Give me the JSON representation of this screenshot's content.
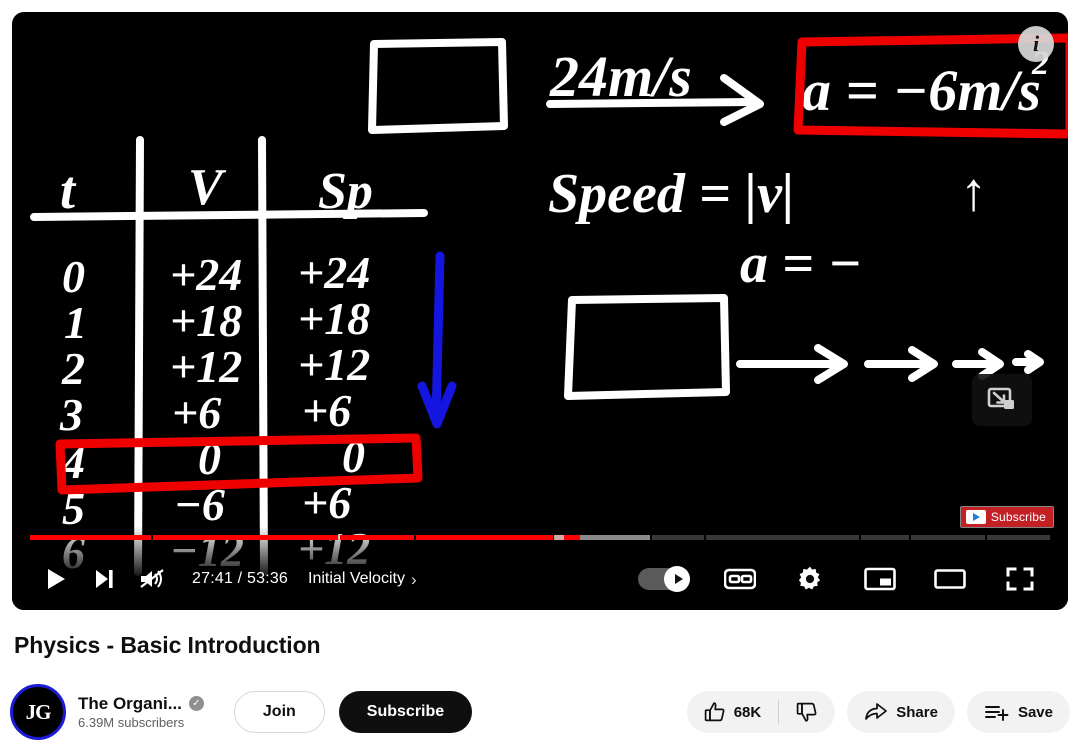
{
  "player": {
    "overlay": {
      "info_icon": "info-icon",
      "expand_icon": "expand-to-miniplayer-icon",
      "watermark_label": "Subscribe"
    },
    "controls": {
      "play_icon": "play-icon",
      "next_icon": "next-video-icon",
      "volume_icon": "volume-muted-icon",
      "time": "27:41 / 53:36",
      "current_time": "27:41",
      "duration": "53:36",
      "chapter": "Initial Velocity",
      "chapter_chevron": "chevron-right-icon",
      "autoplay_icon": "autoplay-toggle",
      "captions_icon": "closed-captions-icon",
      "captions_label": "CC",
      "settings_icon": "gear-icon",
      "miniplayer_icon": "miniplayer-icon",
      "theater_icon": "theater-mode-icon",
      "fullscreen_icon": "fullscreen-icon",
      "progress_percent": 51.4,
      "buffered_percent": 58.0,
      "chapters": [
        {
          "width": 11.5
        },
        {
          "width": 17.5
        },
        {
          "width": 7.0
        },
        {
          "width": 13.0
        },
        {
          "width": 9.0
        },
        {
          "width": 5.0
        },
        {
          "width": 14.5
        },
        {
          "width": 4.5
        },
        {
          "width": 7.0
        },
        {
          "width": 6.0
        }
      ]
    },
    "whiteboard": {
      "table_headers": [
        "t",
        "V",
        "Sp"
      ],
      "table_rows": [
        {
          "t": "0",
          "v": "+24",
          "sp": "+24"
        },
        {
          "t": "1",
          "v": "+18",
          "sp": "+18"
        },
        {
          "t": "2",
          "v": "+12",
          "sp": "+12"
        },
        {
          "t": "3",
          "v": "+6",
          "sp": "+6"
        },
        {
          "t": "4",
          "v": "0",
          "sp": "0"
        },
        {
          "t": "5",
          "v": "-6",
          "sp": "+6"
        },
        {
          "t": "6",
          "v": "-12",
          "sp": "+12"
        }
      ],
      "notes": {
        "velocity_label": "24m/s",
        "acceleration_boxed": "a = -6m/s²",
        "speed_formula": "Speed = |v|",
        "accel_partial": "a = -"
      },
      "annotation_colors": {
        "highlight_box": "#ee0000",
        "arrow": "#1515e0",
        "chalk": "#ffffff"
      }
    }
  },
  "video": {
    "title": "Physics - Basic Introduction",
    "channel": {
      "name": "The Organi...",
      "avatar_initials": "JG",
      "verified_icon": "verified-badge-icon",
      "subscribers": "6.39M subscribers"
    },
    "join_label": "Join",
    "subscribe_label": "Subscribe",
    "actions": {
      "like_icon": "thumbs-up-icon",
      "like_count": "68K",
      "dislike_icon": "thumbs-down-icon",
      "share_icon": "share-arrow-icon",
      "share_label": "Share",
      "save_icon": "save-to-playlist-icon",
      "save_label": "Save"
    }
  }
}
